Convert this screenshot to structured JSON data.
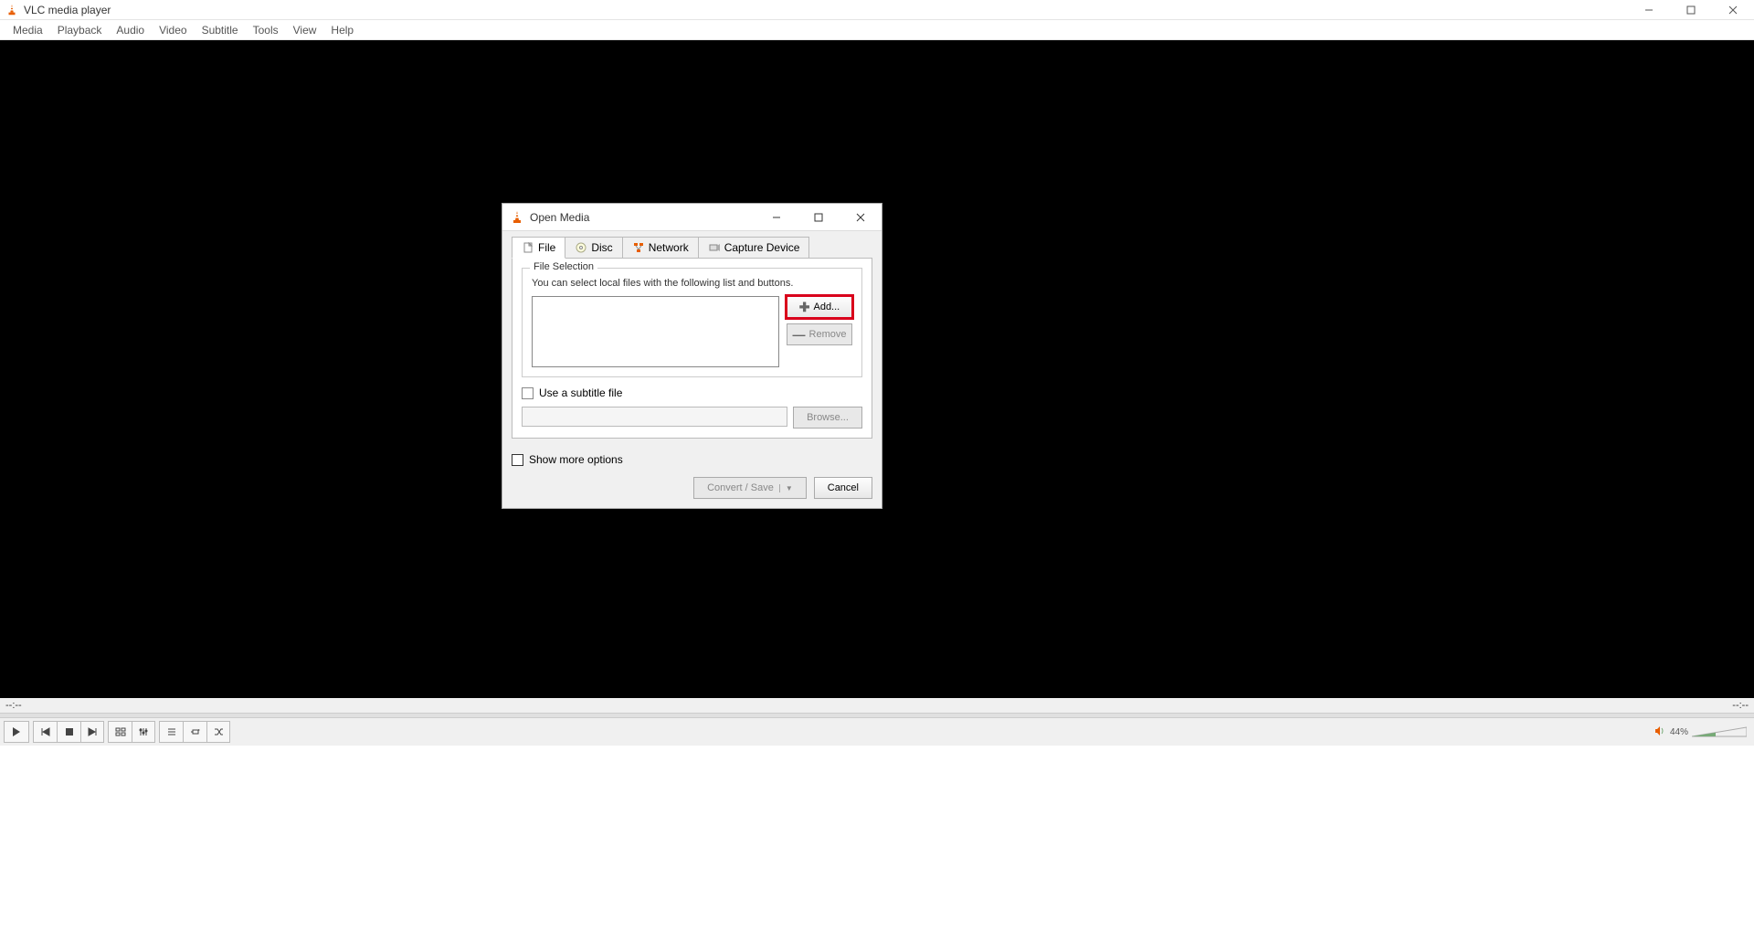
{
  "app": {
    "title": "VLC media player"
  },
  "menu": {
    "items": [
      "Media",
      "Playback",
      "Audio",
      "Video",
      "Subtitle",
      "Tools",
      "View",
      "Help"
    ]
  },
  "status": {
    "time_left": "--:--",
    "time_right": "--:--"
  },
  "volume": {
    "percent": "44%"
  },
  "dialog": {
    "title": "Open Media",
    "tabs": {
      "file": "File",
      "disc": "Disc",
      "network": "Network",
      "capture": "Capture Device"
    },
    "file_selection": {
      "legend": "File Selection",
      "desc": "You can select local files with the following list and buttons.",
      "add_label": "Add...",
      "remove_label": "Remove"
    },
    "subtitle": {
      "checkbox_label": "Use a subtitle file",
      "browse_label": "Browse..."
    },
    "show_more_label": "Show more options",
    "convert_label": "Convert / Save",
    "cancel_label": "Cancel"
  }
}
